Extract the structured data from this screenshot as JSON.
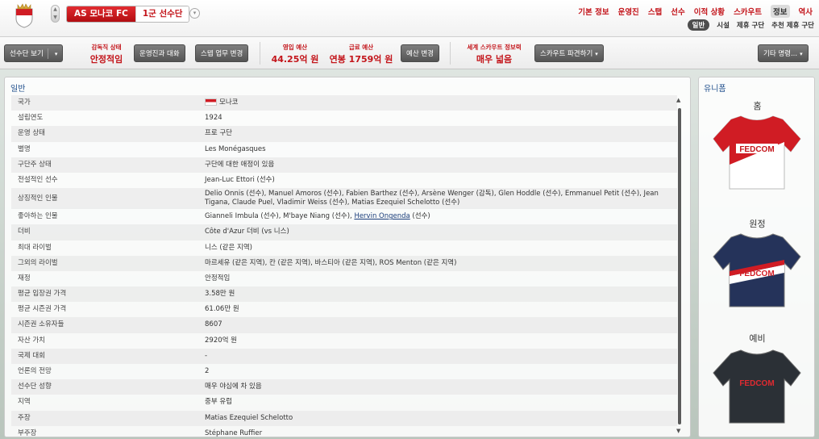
{
  "header": {
    "club_name": "AS 모나코 FC",
    "squad_tab": "1군 선수단",
    "nav": [
      "기본 정보",
      "운영진",
      "스탭",
      "선수",
      "이적 상황",
      "스카우트",
      "정보",
      "역사"
    ],
    "nav_selected": 6,
    "subnav": [
      "일반",
      "시설",
      "제휴 구단",
      "추천 제휴 구단"
    ],
    "subnav_selected": 0
  },
  "toolbar": {
    "squad_view": "선수단 보기",
    "manager_status_label": "감독직 상태",
    "manager_status_value": "안정적임",
    "board_talk": "운영진과 대화",
    "staff_change": "스텝 업무 변경",
    "ops_budget_label": "영입 예산",
    "ops_budget_value": "44.25억 원",
    "wage_budget_label": "급료 예산",
    "wage_budget_value": "연봉 1759억 원",
    "budget_change": "예산 변경",
    "scout_label": "세계 스카우트 정보력",
    "scout_value": "매우 넓음",
    "scout_dispatch": "스카우트 파견하기",
    "other_orders": "기타 명령..."
  },
  "panel": {
    "title": "일반",
    "rows": [
      {
        "k": "국가",
        "v": "모나코",
        "flag": true
      },
      {
        "k": "설립연도",
        "v": "1924"
      },
      {
        "k": "운영 상태",
        "v": "프로 구단"
      },
      {
        "k": "별명",
        "v": "Les Monégasques"
      },
      {
        "k": "구단주 상태",
        "v": "구단에 대한 애정이 있음"
      },
      {
        "k": "전설적인 선수",
        "v": "Jean-Luc Ettori (선수)"
      },
      {
        "k": "상징적인 인물",
        "v": "Delio Onnis (선수), Manuel Amoros (선수), Fabien Barthez (선수), Arsène Wenger (감독), Glen Hoddle (선수), Emmanuel Petit (선수), Jean Tigana, Claude Puel, Vladimir Weiss (선수), Matias Ezequiel Schelotto (선수)",
        "tall": true
      },
      {
        "k": "좋아하는 인물",
        "v": "Gianneli Imbula (선수), M'baye Niang (선수), ",
        "link": "Hervin Ongenda",
        "after": " (선수)"
      },
      {
        "k": "더비",
        "v": "Côte d'Azur 더비 (vs 니스)"
      },
      {
        "k": "최대 라이벌",
        "v": "니스 (같은 지역)"
      },
      {
        "k": "그외의 라이벌",
        "v": "마르세유 (같은 지역), 칸 (같은 지역), 바스티아 (같은 지역), ROS Menton (같은 지역)"
      },
      {
        "k": "재정",
        "v": "안정적임"
      },
      {
        "k": "평균 입장권 가격",
        "v": "3.58만 원"
      },
      {
        "k": "평균 시즌권 가격",
        "v": "61.06만 원"
      },
      {
        "k": "시즌권 소유자들",
        "v": "8607"
      },
      {
        "k": "자산 가치",
        "v": "2920억 원"
      },
      {
        "k": "국제 대회",
        "v": "-"
      },
      {
        "k": "언론의 전망",
        "v": "2"
      },
      {
        "k": "선수단 성향",
        "v": "매우 야심에 차 있음"
      },
      {
        "k": "지역",
        "v": "중부 유럽"
      },
      {
        "k": "주장",
        "v": "Matias Ezequiel Schelotto"
      },
      {
        "k": "부주장",
        "v": "Stéphane Ruffier"
      }
    ]
  },
  "kits": {
    "title": "유니폼",
    "home": "홈",
    "away": "원정",
    "third": "예비",
    "sponsor": "FEDCOM"
  },
  "colors": {
    "accent": "#c3141a",
    "title_blue": "#1f4e8c"
  }
}
